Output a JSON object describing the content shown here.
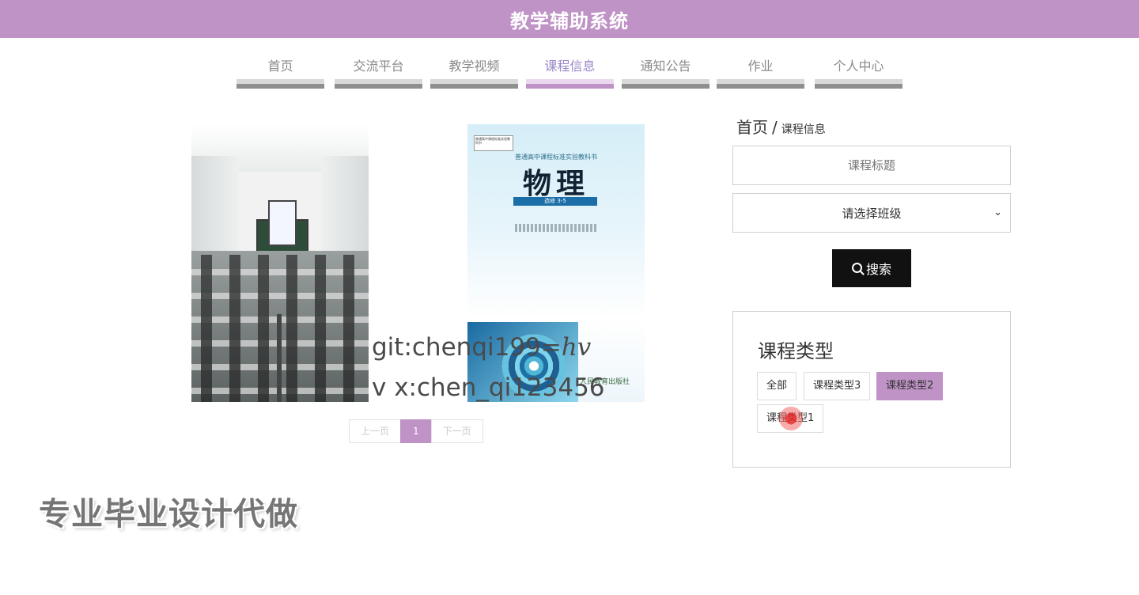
{
  "app": {
    "title": "教学辅助系统"
  },
  "nav": {
    "items": [
      {
        "label": "首页"
      },
      {
        "label": "交流平台"
      },
      {
        "label": "教学视频"
      },
      {
        "label": "课程信息",
        "active": true
      },
      {
        "label": "通知公告"
      },
      {
        "label": "作业"
      },
      {
        "label": "个人中心"
      }
    ]
  },
  "breadcrumb": {
    "home": "首页",
    "separator": "/",
    "current": "课程信息"
  },
  "search": {
    "title_placeholder": "课程标题",
    "class_select_value": "请选择班级",
    "button_label": "搜索"
  },
  "course_types": {
    "heading": "课程类型",
    "tags": [
      {
        "label": "全部"
      },
      {
        "label": "课程类型3"
      },
      {
        "label": "课程类型2",
        "active": true
      },
      {
        "label": "课程类型1"
      }
    ]
  },
  "courses": [
    {
      "image": "classroom-photo"
    },
    {
      "image": "physics-textbook-cover",
      "cover_badge": "普通高中课程标准实验教科书",
      "cover_series": "普通高中课程标准实验教科书",
      "cover_title": "物理",
      "cover_subtitle": "选修 3-5",
      "cover_publisher": "人民教育出版社"
    }
  ],
  "pagination": {
    "prev": "上一页",
    "current": "1",
    "next": "下一页"
  },
  "overlays": {
    "watermark_line1": "git:chenqi199",
    "watermark_formula": "=hv",
    "watermark_line2": "v x:chen_qi123456",
    "ad_text": "专业毕业设计代做"
  },
  "colors": {
    "accent": "#bf93c6",
    "nav_active_text": "#9a86c8",
    "search_button": "#111111"
  }
}
